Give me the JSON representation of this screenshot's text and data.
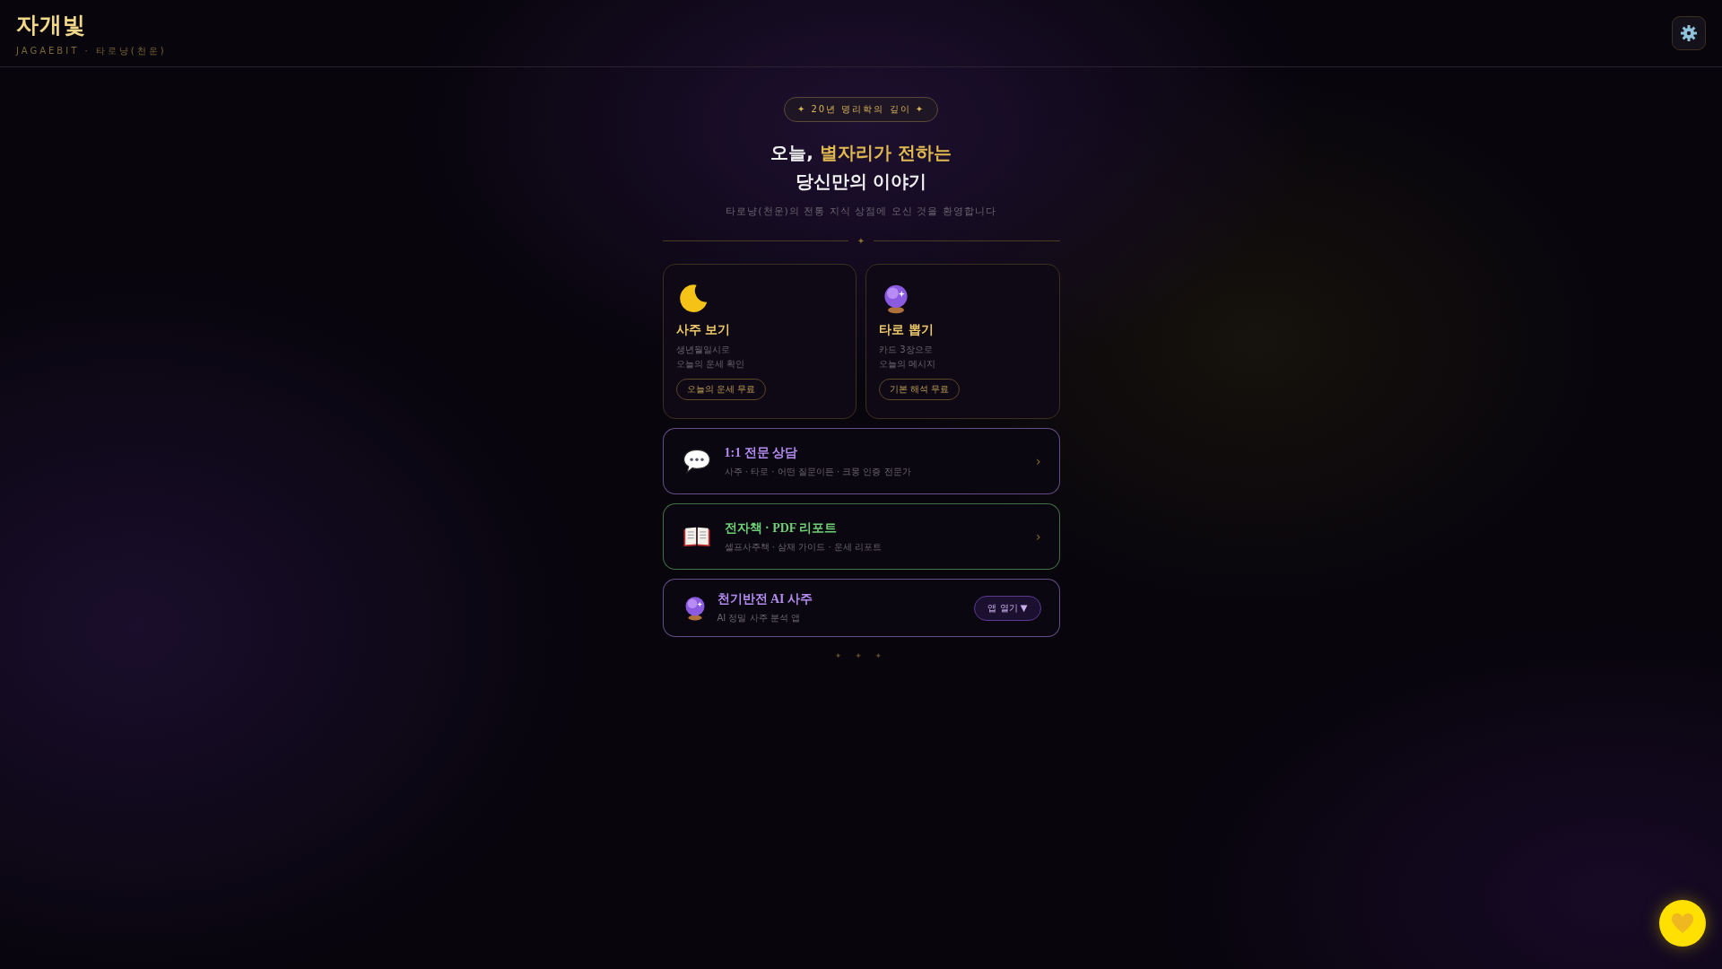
{
  "header": {
    "logo": "자개빛",
    "subtitle": "JAGAEBIT · 타로냥(천운)"
  },
  "hero": {
    "badge": "✦ 20년 명리학의 깊이 ✦",
    "headline_plain": "오늘, ",
    "headline_highlight": "별자리가 전하는",
    "headline_line2": "당신만의 이야기",
    "welcome": "타로냥(천운)의 전통 지식 상점에 오신 것을 환영합니다",
    "divider_mark": "✦"
  },
  "cards": [
    {
      "title": "사주 보기",
      "lines": [
        "생년월일시로",
        "오늘의 운세 확인"
      ],
      "tag": "오늘의 운세 무료"
    },
    {
      "title": "타로 뽑기",
      "lines": [
        "카드 3장으로",
        "오늘의 메시지"
      ],
      "tag": "기본 해석 무료"
    }
  ],
  "rows": [
    {
      "kind": "link",
      "title": "1:1 전문 상담",
      "subtitle": "사주 · 타로 · 어떤 질문이든 · 크몽 인증 전문가",
      "color": "#b38cf0",
      "chevron": "›"
    },
    {
      "kind": "link",
      "title": "전자책 · PDF 리포트",
      "subtitle": "셀프사주책 · 삼재 가이드 · 운세 리포트",
      "color": "#6fcf75",
      "chevron": "›"
    },
    {
      "kind": "app",
      "title": "천기반전 AI 사주",
      "subtitle": "AI 정밀 사주 분석 앱",
      "color": "#b38cf0",
      "button": "앱 열기 ▼"
    }
  ],
  "footer_marks": "✦ ✦ ✦"
}
